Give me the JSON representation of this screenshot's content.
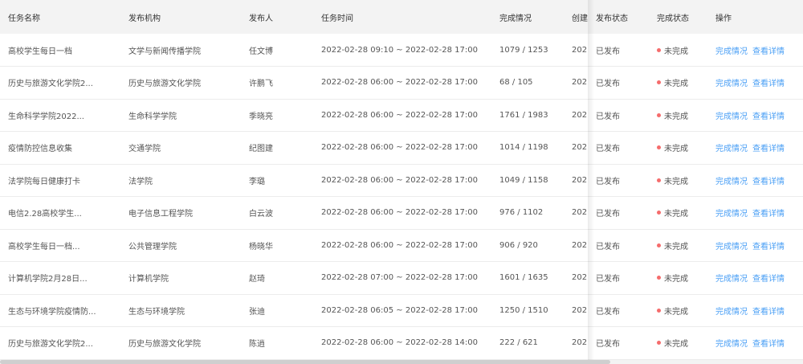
{
  "header": {
    "task_name": "任务名称",
    "org": "发布机构",
    "publisher": "发布人",
    "task_time": "任务时间",
    "completion": "完成情况",
    "created": "创建",
    "publish_status": "发布状态",
    "finish_status": "完成状态",
    "actions": "操作"
  },
  "rows": [
    {
      "name": "高校学生每日一档",
      "org": "文学与新闻传播学院",
      "publisher": "任文博",
      "time": "2022-02-28 09:10 ~ 2022-02-28 17:00",
      "completion": "1079 / 1253",
      "created": "202",
      "publish_status": "已发布",
      "finish_status": "未完成",
      "action1": "完成情况",
      "action2": "查看详情"
    },
    {
      "name": "历史与旅游文化学院2...",
      "org": "历史与旅游文化学院",
      "publisher": "许鹏飞",
      "time": "2022-02-28 06:00 ~ 2022-02-28 17:00",
      "completion": "68 / 105",
      "created": "202",
      "publish_status": "已发布",
      "finish_status": "未完成",
      "action1": "完成情况",
      "action2": "查看详情"
    },
    {
      "name": "生命科学学院2022...",
      "org": "生命科学学院",
      "publisher": "季晓亮",
      "time": "2022-02-28 06:00 ~ 2022-02-28 17:00",
      "completion": "1761 / 1983",
      "created": "202",
      "publish_status": "已发布",
      "finish_status": "未完成",
      "action1": "完成情况",
      "action2": "查看详情"
    },
    {
      "name": "疫情防控信息收集",
      "org": "交通学院",
      "publisher": "纪图建",
      "time": "2022-02-28 06:00 ~ 2022-02-28 17:00",
      "completion": "1014 / 1198",
      "created": "202",
      "publish_status": "已发布",
      "finish_status": "未完成",
      "action1": "完成情况",
      "action2": "查看详情"
    },
    {
      "name": "法学院每日健康打卡",
      "org": "法学院",
      "publisher": "李璐",
      "time": "2022-02-28 06:00 ~ 2022-02-28 17:00",
      "completion": "1049 / 1158",
      "created": "202",
      "publish_status": "已发布",
      "finish_status": "未完成",
      "action1": "完成情况",
      "action2": "查看详情"
    },
    {
      "name": "电信2.28高校学生...",
      "org": "电子信息工程学院",
      "publisher": "白云波",
      "time": "2022-02-28 06:00 ~ 2022-02-28 17:00",
      "completion": "976 / 1102",
      "created": "202",
      "publish_status": "已发布",
      "finish_status": "未完成",
      "action1": "完成情况",
      "action2": "查看详情"
    },
    {
      "name": "高校学生每日一档...",
      "org": "公共管理学院",
      "publisher": "杨晓华",
      "time": "2022-02-28 06:00 ~ 2022-02-28 17:00",
      "completion": "906 / 920",
      "created": "202",
      "publish_status": "已发布",
      "finish_status": "未完成",
      "action1": "完成情况",
      "action2": "查看详情"
    },
    {
      "name": "计算机学院2月28日...",
      "org": "计算机学院",
      "publisher": "赵琦",
      "time": "2022-02-28 07:00 ~ 2022-02-28 17:00",
      "completion": "1601 / 1635",
      "created": "202",
      "publish_status": "已发布",
      "finish_status": "未完成",
      "action1": "完成情况",
      "action2": "查看详情"
    },
    {
      "name": "生态与环境学院疫情防...",
      "org": "生态与环境学院",
      "publisher": "张迪",
      "time": "2022-02-28 06:05 ~ 2022-02-28 17:00",
      "completion": "1250 / 1510",
      "created": "202",
      "publish_status": "已发布",
      "finish_status": "未完成",
      "action1": "完成情况",
      "action2": "查看详情"
    },
    {
      "name": "历史与旅游文化学院2...",
      "org": "历史与旅游文化学院",
      "publisher": "陈逍",
      "time": "2022-02-28 06:00 ~ 2022-02-28 14:00",
      "completion": "222 / 621",
      "created": "202",
      "publish_status": "已发布",
      "finish_status": "未完成",
      "action1": "完成情况",
      "action2": "查看详情"
    }
  ],
  "colors": {
    "link": "#4a9ff5",
    "status_dot": "#f56c6c",
    "header_bg": "#f3f3f3"
  }
}
